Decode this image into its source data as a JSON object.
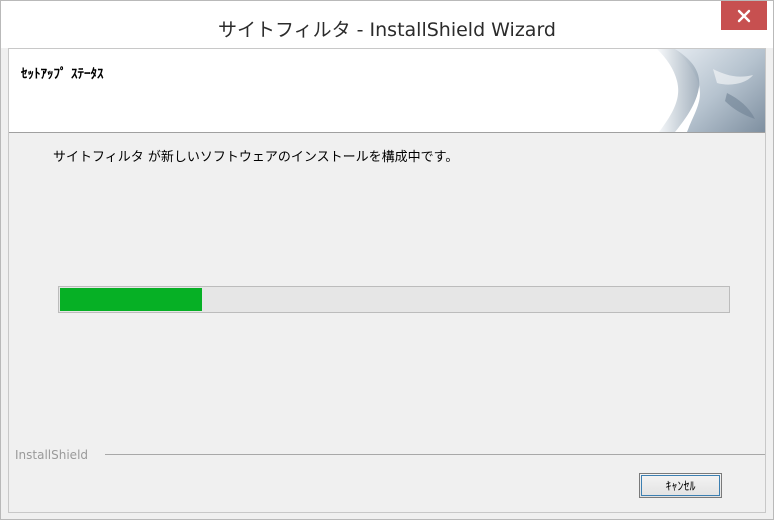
{
  "window": {
    "title": "サイトフィルタ - InstallShield Wizard"
  },
  "header": {
    "title": "ｾｯﾄｱｯﾌﾟ ｽﾃｰﾀｽ"
  },
  "main": {
    "status_text": "サイトフィルタ が新しいソフトウェアのインストールを構成中です。",
    "progress_fraction": 0.215
  },
  "footer": {
    "brand": "InstallShield",
    "cancel_label": "ｷｬﾝｾﾙ"
  },
  "colors": {
    "progress_fill": "#06b025",
    "close_button": "#c75050"
  },
  "icons": {
    "close": "close-icon",
    "header_art": "installshield-logo-art"
  }
}
